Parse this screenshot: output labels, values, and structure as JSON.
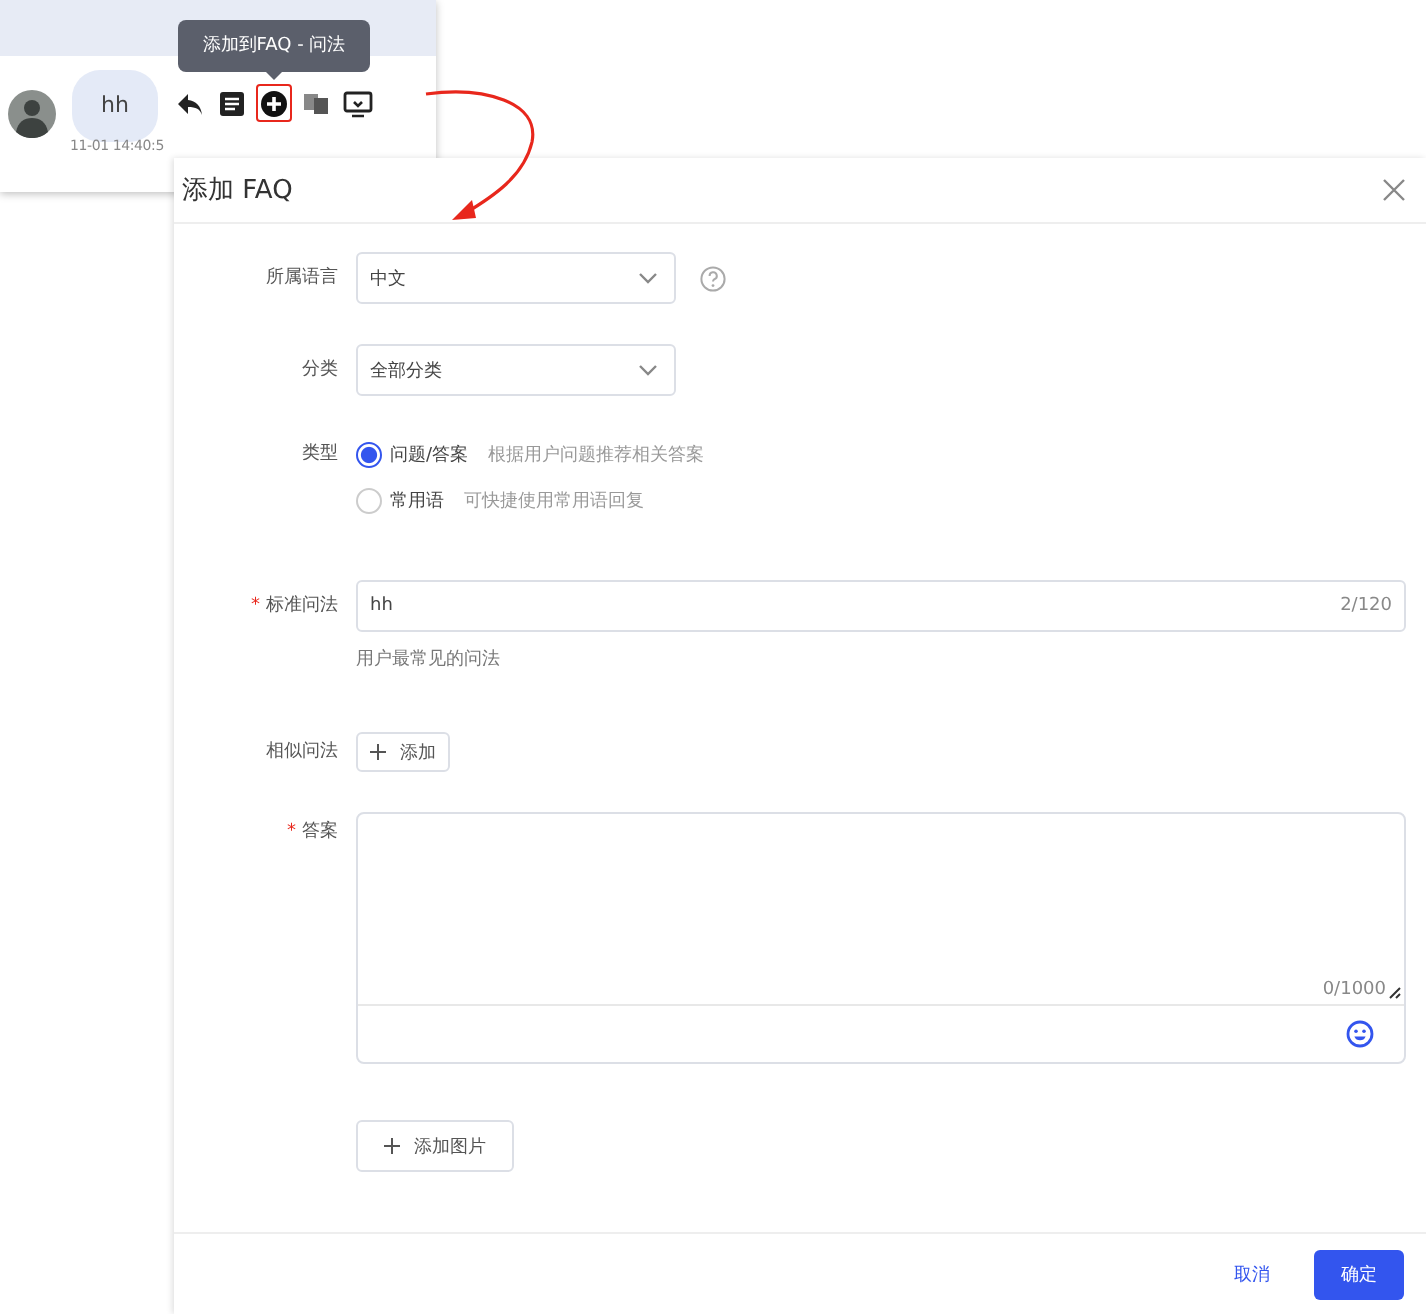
{
  "chat": {
    "message": "hh",
    "time": "11-01 14:40:5",
    "tooltip": "添加到FAQ - 问法"
  },
  "dialog": {
    "title": "添加 FAQ",
    "fields": [
      {
        "kind": "select",
        "label": "所属语言",
        "value": "中文",
        "help": true
      },
      {
        "kind": "select",
        "label": "分类",
        "value": "全部分类",
        "help": false
      },
      {
        "kind": "radio",
        "label": "类型",
        "options": [
          {
            "label": "问题/答案",
            "hint": "根据用户问题推荐相关答案",
            "selected": true
          },
          {
            "label": "常用语",
            "hint": "可快捷使用常用语回复",
            "selected": false
          }
        ]
      },
      {
        "kind": "input",
        "label": "标准问法",
        "mark": "*",
        "value": "hh",
        "count": "2/120",
        "note": "用户最常见的问法"
      },
      {
        "kind": "add",
        "label": "相似问法",
        "button": "添加"
      },
      {
        "kind": "textarea",
        "label": "答案",
        "mark": "*",
        "count": "0/1000"
      },
      {
        "kind": "add",
        "button": "添加图片"
      }
    ],
    "buttons": [
      {
        "label": "取消",
        "primary": false
      },
      {
        "label": "确定",
        "primary": true
      }
    ]
  }
}
